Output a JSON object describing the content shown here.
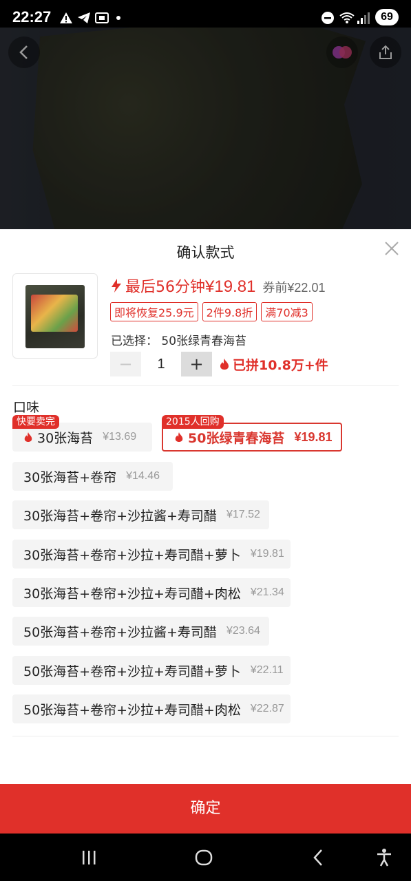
{
  "status_bar": {
    "time": "22:27",
    "battery": "69",
    "icons": [
      "alert-icon",
      "telegram-icon",
      "screenshot-icon",
      "dot-icon",
      "dnd-icon",
      "wifi-icon",
      "signal-icon"
    ]
  },
  "sheet": {
    "title": "确认款式",
    "price": {
      "flash_icon": "lightning-icon",
      "label": "最后56分钟",
      "value": "¥19.81",
      "before_coupon": "券前¥22.01"
    },
    "tags": [
      "即将恢复25.9元",
      "2件9.8折",
      "满70减3"
    ],
    "selected_text": "已选择：  50张绿青春海苔",
    "quantity": "1",
    "sold_text": "已拼10.8万+件",
    "group_label": "口味",
    "options": [
      {
        "name": "30张海苔",
        "price": "¥13.69",
        "badge": "快要卖完",
        "hot": true
      },
      {
        "name": "50张绿青春海苔",
        "price": "¥19.81",
        "badge": "2015人回购",
        "hot": true,
        "selected": true
      },
      {
        "name": "30张海苔+卷帘",
        "price": "¥14.46"
      },
      {
        "name": "30张海苔+卷帘+沙拉酱+寿司醋",
        "price": "¥17.52"
      },
      {
        "name": "30张海苔+卷帘+沙拉+寿司醋+萝卜",
        "price": "¥19.81"
      },
      {
        "name": "30张海苔+卷帘+沙拉+寿司醋+肉松",
        "price": "¥21.34"
      },
      {
        "name": "50张海苔+卷帘+沙拉酱+寿司醋",
        "price": "¥23.64"
      },
      {
        "name": "50张海苔+卷帘+沙拉+寿司醋+萝卜",
        "price": "¥22.11"
      },
      {
        "name": "50张海苔+卷帘+沙拉+寿司醋+肉松",
        "price": "¥22.87"
      }
    ],
    "confirm_label": "确定"
  },
  "colors": {
    "accent": "#e0302a",
    "option_bg": "#f4f4f4"
  }
}
